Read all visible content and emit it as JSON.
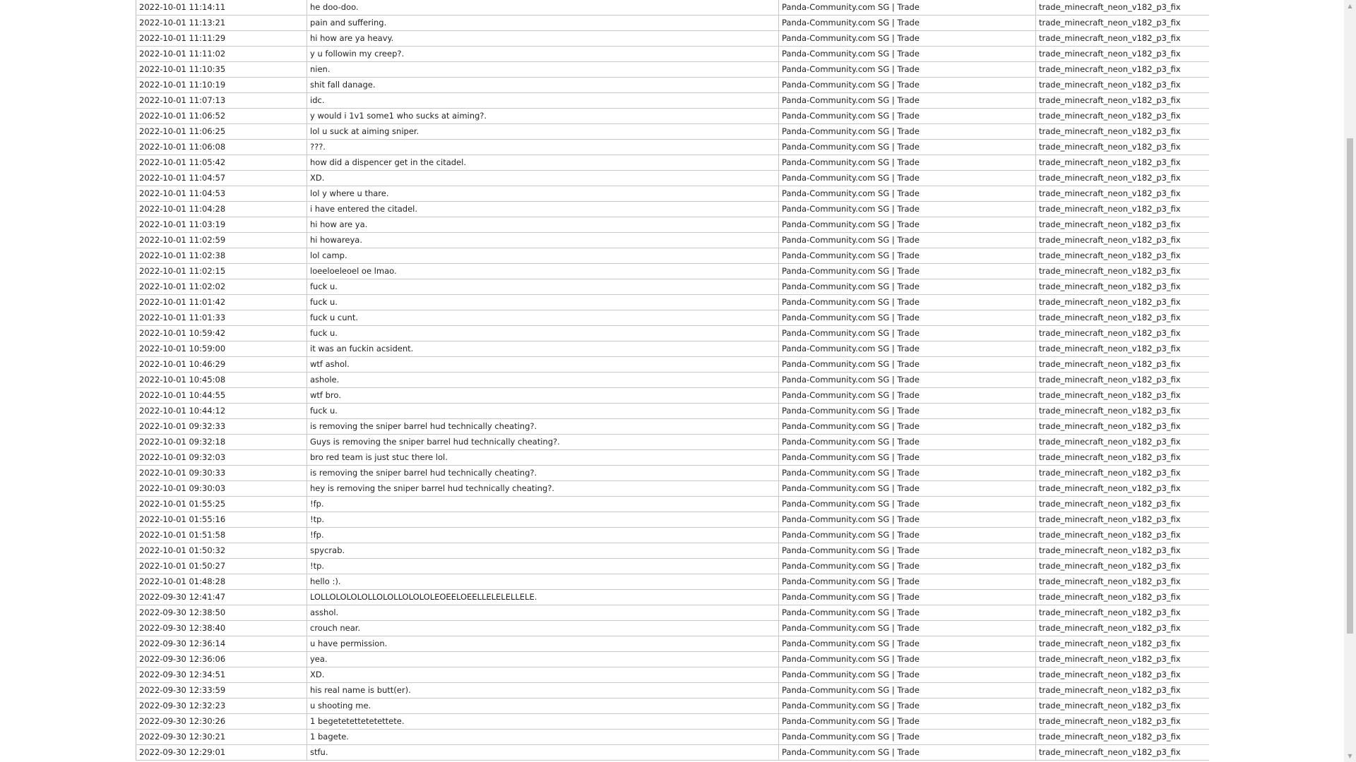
{
  "rows": [
    {
      "time": "2022-10-01 11:14:11",
      "message": "he doo-doo.",
      "server": "Panda-Community.com SG | Trade",
      "map": "trade_minecraft_neon_v182_p3_fix"
    },
    {
      "time": "2022-10-01 11:13:21",
      "message": "pain and suffering.",
      "server": "Panda-Community.com SG | Trade",
      "map": "trade_minecraft_neon_v182_p3_fix"
    },
    {
      "time": "2022-10-01 11:11:29",
      "message": "hi how are ya heavy.",
      "server": "Panda-Community.com SG | Trade",
      "map": "trade_minecraft_neon_v182_p3_fix"
    },
    {
      "time": "2022-10-01 11:11:02",
      "message": "y u followin my creep?.",
      "server": "Panda-Community.com SG | Trade",
      "map": "trade_minecraft_neon_v182_p3_fix"
    },
    {
      "time": "2022-10-01 11:10:35",
      "message": "nien.",
      "server": "Panda-Community.com SG | Trade",
      "map": "trade_minecraft_neon_v182_p3_fix"
    },
    {
      "time": "2022-10-01 11:10:19",
      "message": "shit fall danage.",
      "server": "Panda-Community.com SG | Trade",
      "map": "trade_minecraft_neon_v182_p3_fix"
    },
    {
      "time": "2022-10-01 11:07:13",
      "message": "idc.",
      "server": "Panda-Community.com SG | Trade",
      "map": "trade_minecraft_neon_v182_p3_fix"
    },
    {
      "time": "2022-10-01 11:06:52",
      "message": "y would i 1v1 some1 who sucks at aiming?.",
      "server": "Panda-Community.com SG | Trade",
      "map": "trade_minecraft_neon_v182_p3_fix"
    },
    {
      "time": "2022-10-01 11:06:25",
      "message": "lol u suck at aiming sniper.",
      "server": "Panda-Community.com SG | Trade",
      "map": "trade_minecraft_neon_v182_p3_fix"
    },
    {
      "time": "2022-10-01 11:06:08",
      "message": "???.",
      "server": "Panda-Community.com SG | Trade",
      "map": "trade_minecraft_neon_v182_p3_fix"
    },
    {
      "time": "2022-10-01 11:05:42",
      "message": "how did a dispencer get in the citadel.",
      "server": "Panda-Community.com SG | Trade",
      "map": "trade_minecraft_neon_v182_p3_fix"
    },
    {
      "time": "2022-10-01 11:04:57",
      "message": "XD.",
      "server": "Panda-Community.com SG | Trade",
      "map": "trade_minecraft_neon_v182_p3_fix"
    },
    {
      "time": "2022-10-01 11:04:53",
      "message": "lol y where u thare.",
      "server": "Panda-Community.com SG | Trade",
      "map": "trade_minecraft_neon_v182_p3_fix"
    },
    {
      "time": "2022-10-01 11:04:28",
      "message": "i have entered the citadel.",
      "server": "Panda-Community.com SG | Trade",
      "map": "trade_minecraft_neon_v182_p3_fix"
    },
    {
      "time": "2022-10-01 11:03:19",
      "message": "hi how are ya.",
      "server": "Panda-Community.com SG | Trade",
      "map": "trade_minecraft_neon_v182_p3_fix"
    },
    {
      "time": "2022-10-01 11:02:59",
      "message": "hi howareya.",
      "server": "Panda-Community.com SG | Trade",
      "map": "trade_minecraft_neon_v182_p3_fix"
    },
    {
      "time": "2022-10-01 11:02:38",
      "message": "lol camp.",
      "server": "Panda-Community.com SG | Trade",
      "map": "trade_minecraft_neon_v182_p3_fix"
    },
    {
      "time": "2022-10-01 11:02:15",
      "message": "loeeloeleoel oe lmao.",
      "server": "Panda-Community.com SG | Trade",
      "map": "trade_minecraft_neon_v182_p3_fix"
    },
    {
      "time": "2022-10-01 11:02:02",
      "message": "fuck u.",
      "server": "Panda-Community.com SG | Trade",
      "map": "trade_minecraft_neon_v182_p3_fix"
    },
    {
      "time": "2022-10-01 11:01:42",
      "message": "fuck u.",
      "server": "Panda-Community.com SG | Trade",
      "map": "trade_minecraft_neon_v182_p3_fix"
    },
    {
      "time": "2022-10-01 11:01:33",
      "message": "fuck u cunt.",
      "server": "Panda-Community.com SG | Trade",
      "map": "trade_minecraft_neon_v182_p3_fix"
    },
    {
      "time": "2022-10-01 10:59:42",
      "message": "fuck u.",
      "server": "Panda-Community.com SG | Trade",
      "map": "trade_minecraft_neon_v182_p3_fix"
    },
    {
      "time": "2022-10-01 10:59:00",
      "message": "it was an fuckin acsident.",
      "server": "Panda-Community.com SG | Trade",
      "map": "trade_minecraft_neon_v182_p3_fix"
    },
    {
      "time": "2022-10-01 10:46:29",
      "message": "wtf ashol.",
      "server": "Panda-Community.com SG | Trade",
      "map": "trade_minecraft_neon_v182_p3_fix"
    },
    {
      "time": "2022-10-01 10:45:08",
      "message": "ashole.",
      "server": "Panda-Community.com SG | Trade",
      "map": "trade_minecraft_neon_v182_p3_fix"
    },
    {
      "time": "2022-10-01 10:44:55",
      "message": "wtf bro.",
      "server": "Panda-Community.com SG | Trade",
      "map": "trade_minecraft_neon_v182_p3_fix"
    },
    {
      "time": "2022-10-01 10:44:12",
      "message": "fuck u.",
      "server": "Panda-Community.com SG | Trade",
      "map": "trade_minecraft_neon_v182_p3_fix"
    },
    {
      "time": "2022-10-01 09:32:33",
      "message": "is removing the sniper barrel hud technically cheating?.",
      "server": "Panda-Community.com SG | Trade",
      "map": "trade_minecraft_neon_v182_p3_fix"
    },
    {
      "time": "2022-10-01 09:32:18",
      "message": "Guys is removing the sniper barrel hud technically cheating?.",
      "server": "Panda-Community.com SG | Trade",
      "map": "trade_minecraft_neon_v182_p3_fix"
    },
    {
      "time": "2022-10-01 09:32:03",
      "message": "bro red team is just stuc there lol.",
      "server": "Panda-Community.com SG | Trade",
      "map": "trade_minecraft_neon_v182_p3_fix"
    },
    {
      "time": "2022-10-01 09:30:33",
      "message": "is removing the sniper barrel hud technically cheating?.",
      "server": "Panda-Community.com SG | Trade",
      "map": "trade_minecraft_neon_v182_p3_fix"
    },
    {
      "time": "2022-10-01 09:30:03",
      "message": "hey is removing the sniper barrel hud technically cheating?.",
      "server": "Panda-Community.com SG | Trade",
      "map": "trade_minecraft_neon_v182_p3_fix"
    },
    {
      "time": "2022-10-01 01:55:25",
      "message": "!fp.",
      "server": "Panda-Community.com SG | Trade",
      "map": "trade_minecraft_neon_v182_p3_fix"
    },
    {
      "time": "2022-10-01 01:55:16",
      "message": "!tp.",
      "server": "Panda-Community.com SG | Trade",
      "map": "trade_minecraft_neon_v182_p3_fix"
    },
    {
      "time": "2022-10-01 01:51:58",
      "message": "!fp.",
      "server": "Panda-Community.com SG | Trade",
      "map": "trade_minecraft_neon_v182_p3_fix"
    },
    {
      "time": "2022-10-01 01:50:32",
      "message": "spycrab.",
      "server": "Panda-Community.com SG | Trade",
      "map": "trade_minecraft_neon_v182_p3_fix"
    },
    {
      "time": "2022-10-01 01:50:27",
      "message": "!tp.",
      "server": "Panda-Community.com SG | Trade",
      "map": "trade_minecraft_neon_v182_p3_fix"
    },
    {
      "time": "2022-10-01 01:48:28",
      "message": "hello :).",
      "server": "Panda-Community.com SG | Trade",
      "map": "trade_minecraft_neon_v182_p3_fix"
    },
    {
      "time": "2022-09-30 12:41:47",
      "message": "LOLLOLOLOLOLLOLOLLOLOLOLEOEELOEELLELELELLELE.",
      "server": "Panda-Community.com SG | Trade",
      "map": "trade_minecraft_neon_v182_p3_fix"
    },
    {
      "time": "2022-09-30 12:38:50",
      "message": "asshol.",
      "server": "Panda-Community.com SG | Trade",
      "map": "trade_minecraft_neon_v182_p3_fix"
    },
    {
      "time": "2022-09-30 12:38:40",
      "message": "crouch near.",
      "server": "Panda-Community.com SG | Trade",
      "map": "trade_minecraft_neon_v182_p3_fix"
    },
    {
      "time": "2022-09-30 12:36:14",
      "message": "u have permission.",
      "server": "Panda-Community.com SG | Trade",
      "map": "trade_minecraft_neon_v182_p3_fix"
    },
    {
      "time": "2022-09-30 12:36:06",
      "message": "yea.",
      "server": "Panda-Community.com SG | Trade",
      "map": "trade_minecraft_neon_v182_p3_fix"
    },
    {
      "time": "2022-09-30 12:34:51",
      "message": "XD.",
      "server": "Panda-Community.com SG | Trade",
      "map": "trade_minecraft_neon_v182_p3_fix"
    },
    {
      "time": "2022-09-30 12:33:59",
      "message": "his real name is butt(er).",
      "server": "Panda-Community.com SG | Trade",
      "map": "trade_minecraft_neon_v182_p3_fix"
    },
    {
      "time": "2022-09-30 12:32:23",
      "message": "u shooting me.",
      "server": "Panda-Community.com SG | Trade",
      "map": "trade_minecraft_neon_v182_p3_fix"
    },
    {
      "time": "2022-09-30 12:30:26",
      "message": "1 begetetettetetettete.",
      "server": "Panda-Community.com SG | Trade",
      "map": "trade_minecraft_neon_v182_p3_fix"
    },
    {
      "time": "2022-09-30 12:30:21",
      "message": "1 bagete.",
      "server": "Panda-Community.com SG | Trade",
      "map": "trade_minecraft_neon_v182_p3_fix"
    },
    {
      "time": "2022-09-30 12:29:01",
      "message": "stfu.",
      "server": "Panda-Community.com SG | Trade",
      "map": "trade_minecraft_neon_v182_p3_fix"
    }
  ],
  "colors": {
    "background": "#ffffff",
    "grid_line": "#c8c8c8",
    "text": "#222222",
    "scrollbar_track": "#f1f1f1",
    "scrollbar_thumb": "#c1c1c1"
  },
  "scrollbar": {
    "up_icon": "scroll-up-arrow-icon",
    "down_icon": "scroll-down-arrow-icon"
  }
}
